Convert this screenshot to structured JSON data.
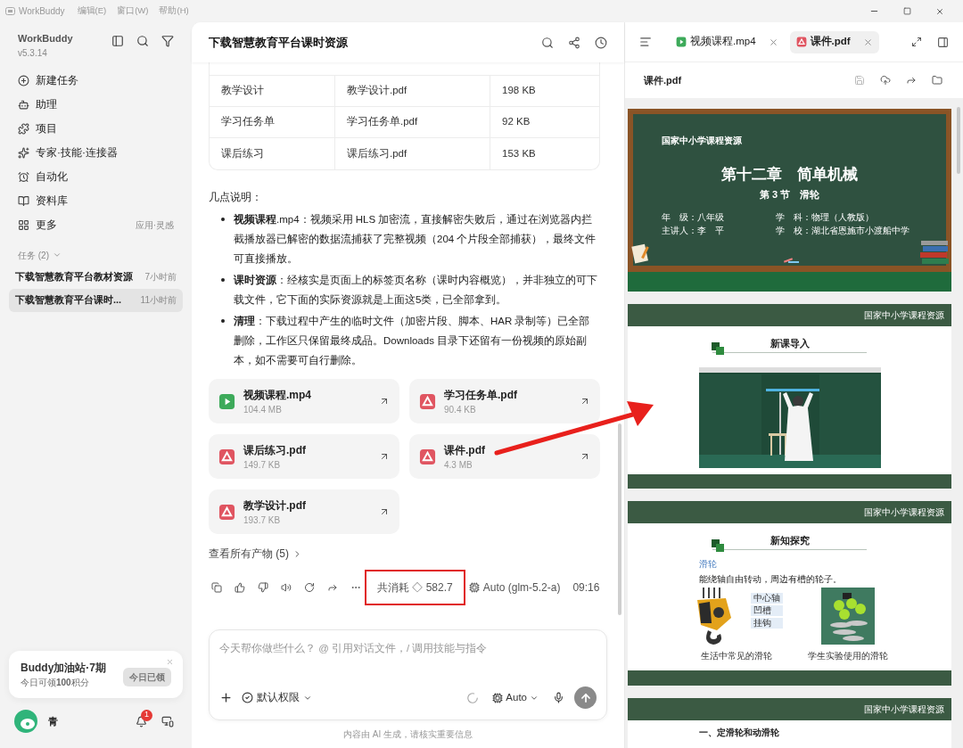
{
  "titlebar": {
    "app": "WorkBuddy",
    "menus": [
      "编辑(E)",
      "窗口(W)",
      "帮助(H)"
    ]
  },
  "sidebar": {
    "app_name": "WorkBuddy",
    "version": "v5.3.14",
    "nav": [
      {
        "label": "新建任务",
        "kind": "new"
      },
      {
        "label": "助理",
        "kind": "assistant"
      },
      {
        "label": "项目",
        "kind": "project"
      },
      {
        "label": "专家·技能·连接器",
        "kind": "experts"
      },
      {
        "label": "自动化",
        "kind": "automation"
      },
      {
        "label": "资料库",
        "kind": "library"
      },
      {
        "label": "更多",
        "kind": "more",
        "hint": "应用·灵感"
      }
    ],
    "tasks_header": "任务 (2)",
    "tasks": [
      {
        "title": "下载智慧教育平台教材资源",
        "time": "7小时前",
        "selected": false
      },
      {
        "title": "下载智慧教育平台课时...",
        "time": "11小时前",
        "selected": true
      }
    ],
    "promo": {
      "title": "Buddy加油站·7期",
      "text": "今日可领**100**积分",
      "button": "今日已领",
      "disabled": true
    },
    "user": {
      "name": "青",
      "notifications": "1"
    }
  },
  "chat": {
    "title": "下载智慧教育平台课时资源",
    "table": {
      "rows": [
        [
          "教学设计",
          "教学设计.pdf",
          "198 KB"
        ],
        [
          "学习任务单",
          "学习任务单.pdf",
          "92 KB"
        ],
        [
          "课后练习",
          "课后练习.pdf",
          "153 KB"
        ]
      ]
    },
    "notes_title": "几点说明：",
    "notes": [
      "**视频课程**.mp4：视频采用 HLS 加密流，直接解密失败后，通过在浏览器内拦截播放器已解密的数据流捕获了完整视频（204 个片段全部捕获），最终文件可直接播放。",
      "**课时资源**：经核实是页面上的标签页名称（课时内容概览），并非独立的可下载文件，它下面的实际资源就是上面这5类，已全部拿到。",
      "**清理**：下载过程中产生的临时文件（加密片段、脚本、HAR 录制等）已全部删除，工作区只保留最终成品。Downloads 目录下还留有一份视频的原始副本，如不需要可自行删除。"
    ],
    "files": [
      {
        "name": "视频课程.mp4",
        "size": "104.4 MB",
        "kind": "video"
      },
      {
        "name": "学习任务单.pdf",
        "size": "90.4 KB",
        "kind": "pdf"
      },
      {
        "name": "课后练习.pdf",
        "size": "149.7 KB",
        "kind": "pdf"
      },
      {
        "name": "课件.pdf",
        "size": "4.3 MB",
        "kind": "pdf"
      },
      {
        "name": "教学设计.pdf",
        "size": "193.7 KB",
        "kind": "pdf"
      }
    ],
    "all_outputs": "查看所有产物 (5)",
    "cost": "共消耗 ◇ 582.7",
    "cost_highlighted": true,
    "model": "Auto (glm-5.2-a)",
    "time": "09:16",
    "input": {
      "placeholder": "今天帮你做些什么？ @ 引用对话文件，/ 调用技能与指令",
      "permission": "默认权限",
      "model": "Auto"
    },
    "disclaimer": "内容由 AI 生成，请核实重要信息"
  },
  "viewer": {
    "tabs": [
      {
        "label": "视频课程.mp4",
        "kind": "video",
        "selected": false
      },
      {
        "label": "课件.pdf",
        "kind": "pdf",
        "selected": true
      }
    ],
    "file_title": "课件.pdf",
    "pages": [
      {
        "kind": "cover",
        "source": "国家中小学课程资源",
        "chapter": "第十二章　简单机械",
        "section": "第 3 节　滑轮",
        "meta": [
          "年　级：八年级",
          "学　科：物理（人教版）",
          "主讲人：李　平",
          "学　校：湖北省恩施市小渡船中学"
        ]
      },
      {
        "banner": "国家中小学课程资源",
        "heading": "新课导入"
      },
      {
        "kind": "figures",
        "banner": "国家中小学课程资源",
        "heading": "新知探究",
        "term": "滑轮",
        "definition": "能绕轴自由转动，周边有槽的轮子。",
        "labels": [
          "中心轴",
          "凹槽",
          "挂钩"
        ],
        "captions": [
          "生活中常见的滑轮",
          "学生实验使用的滑轮"
        ]
      },
      {
        "kind": "text",
        "banner": "国家中小学课程资源",
        "heading": "一、定滑轮和动滑轮"
      }
    ]
  }
}
